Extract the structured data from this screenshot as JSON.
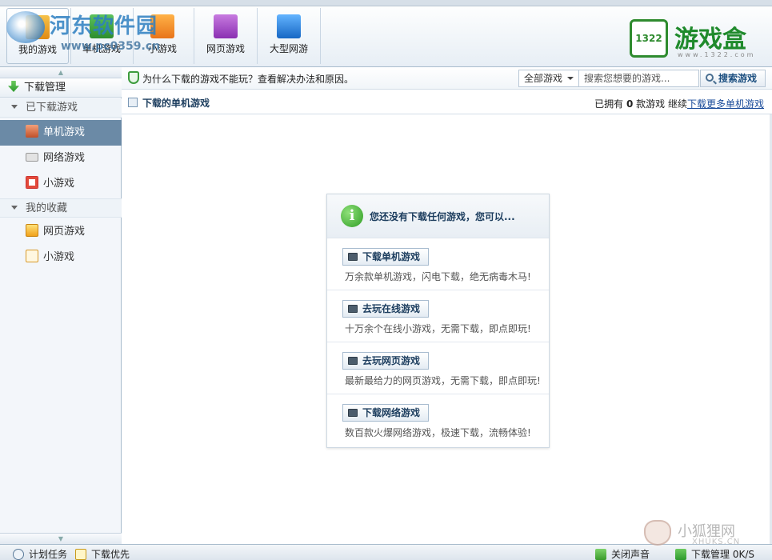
{
  "toolbar": {
    "tabs": [
      {
        "label": "我的游戏",
        "icon": "my-games-icon",
        "active": true
      },
      {
        "label": "单机游戏",
        "icon": "single-games-icon"
      },
      {
        "label": "小游戏",
        "icon": "flash-games-icon"
      },
      {
        "label": "网页游戏",
        "icon": "web-games-icon"
      },
      {
        "label": "大型网游",
        "icon": "online-games-icon"
      }
    ],
    "brand_logo_text": "1322",
    "brand_name": "游戏盒",
    "brand_url": "www.1322.com"
  },
  "watermark": {
    "title": "河东软件园",
    "url": "www.pc0359.cn"
  },
  "sidebar": {
    "download_manage": "下载管理",
    "group_downloaded": "已下载游戏",
    "downloaded_items": [
      {
        "label": "单机游戏",
        "icon": "single-game-icon",
        "active": true
      },
      {
        "label": "网络游戏",
        "icon": "keyboard-icon"
      },
      {
        "label": "小游戏",
        "icon": "flash-icon"
      }
    ],
    "group_favorites": "我的收藏",
    "favorite_items": [
      {
        "label": "网页游戏",
        "icon": "web-game-icon"
      },
      {
        "label": "小游戏",
        "icon": "pencil-icon"
      }
    ]
  },
  "tipbar": {
    "text": "为什么下载的游戏不能玩？查看解决办法和原因。",
    "filter_selected": "全部游戏",
    "search_placeholder": "搜索您想要的游戏...",
    "search_button": "搜索游戏"
  },
  "listhead": {
    "title": "下载的单机游戏",
    "owned_prefix": "已拥有",
    "owned_count": "0",
    "owned_suffix": "款游戏",
    "continue_text": "继续",
    "more_link": "下载更多单机游戏"
  },
  "empty_card": {
    "title": "您还没有下载任何游戏，您可以...",
    "options": [
      {
        "button": "下载单机游戏",
        "desc": "万余款单机游戏，闪电下载，绝无病毒木马!"
      },
      {
        "button": "去玩在线游戏",
        "desc": "十万余个在线小游戏，无需下载，即点即玩!"
      },
      {
        "button": "去玩网页游戏",
        "desc": "最新最给力的网页游戏，无需下载，即点即玩!"
      },
      {
        "button": "下载网络游戏",
        "desc": "数百款火爆网络游戏，极速下载，流畅体验!"
      }
    ]
  },
  "statusbar": {
    "schedule": "计划任务",
    "download_priority": "下载优先",
    "mute": "关闭声音",
    "download_manage": "下载管理",
    "speed": "0K/S"
  },
  "fox_watermark": {
    "cn": "小狐狸网",
    "en": "XHUKS.CN"
  },
  "colors": {
    "accent": "#6b8aa6",
    "brand_green": "#1f8a2c",
    "link": "#1a4b9a"
  }
}
